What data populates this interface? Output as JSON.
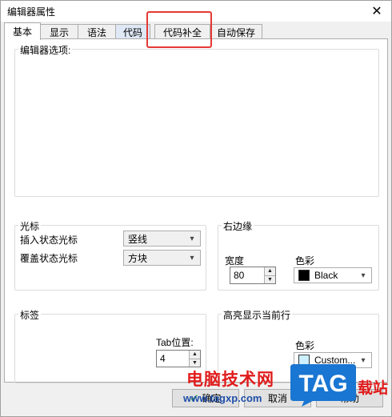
{
  "window": {
    "title": "编辑器属性",
    "close_glyph": "✕"
  },
  "tabs": [
    {
      "label": "基本",
      "active": true
    },
    {
      "label": "显示"
    },
    {
      "label": "语法"
    },
    {
      "label": "代码"
    },
    {
      "label": "代码补全"
    },
    {
      "label": "自动保存"
    }
  ],
  "editor_options": {
    "label": "编辑器选项:"
  },
  "cursor": {
    "label": "光标",
    "insert_label": "插入状态光标",
    "insert_value": "竖线",
    "overwrite_label": "覆盖状态光标",
    "overwrite_value": "方块"
  },
  "right_edge": {
    "label": "右边缘",
    "width_label": "宽度",
    "width_value": "80",
    "color_label": "色彩",
    "color_value": "Black",
    "color_hex": "#000000"
  },
  "tags": {
    "label": "标签",
    "tab_label": "Tab位置:",
    "tab_value": "4"
  },
  "highlight_line": {
    "label": "高亮显示当前行",
    "color_label": "色彩",
    "color_value": "Custom...",
    "color_hex": "#ccf0ff"
  },
  "buttons": {
    "ok_label": "确定",
    "cancel_label": "取消",
    "help_label": "帮助"
  },
  "watermark": {
    "cn_text": "电脑技术网",
    "url": "www.tagxp.com",
    "logo_text": "TAG",
    "tail_text": "载站"
  },
  "colors": {
    "accent_red": "#e53935",
    "logo_blue": "#1976d2"
  }
}
